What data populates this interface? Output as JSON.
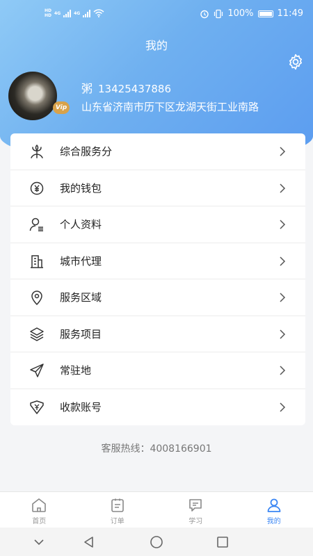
{
  "status_bar": {
    "left_hd_1": "HD",
    "left_hd_2": "HD",
    "net_1": "4G",
    "net_2": "4G",
    "battery_pct": "100%",
    "time": "11:49"
  },
  "header": {
    "title": "我的",
    "settings_icon": "gear-icon"
  },
  "profile": {
    "avatar_badge": "Vip",
    "name": "粥",
    "phone": "13425437886",
    "address": "山东省济南市历下区龙湖天街工业南路"
  },
  "menu": [
    {
      "label": "综合服务分",
      "icon": "flower-icon"
    },
    {
      "label": "我的钱包",
      "icon": "yuan-circle-icon"
    },
    {
      "label": "个人资料",
      "icon": "user-profile-icon"
    },
    {
      "label": "城市代理",
      "icon": "building-icon"
    },
    {
      "label": "服务区域",
      "icon": "location-pin-icon"
    },
    {
      "label": "服务项目",
      "icon": "layers-icon"
    },
    {
      "label": "常驻地",
      "icon": "paper-plane-icon"
    },
    {
      "label": "收款账号",
      "icon": "yuan-envelope-icon"
    }
  ],
  "hotline": "客服热线：4008166901",
  "tabs": [
    {
      "label": "首页",
      "icon": "home-icon",
      "active": false
    },
    {
      "label": "订单",
      "icon": "clipboard-icon",
      "active": false
    },
    {
      "label": "学习",
      "icon": "chat-icon",
      "active": false
    },
    {
      "label": "我的",
      "icon": "person-icon",
      "active": true
    }
  ],
  "colors": {
    "accent": "#3a86f4",
    "header_gradient_start": "#8fcaf6",
    "header_gradient_end": "#5b9cf0"
  }
}
